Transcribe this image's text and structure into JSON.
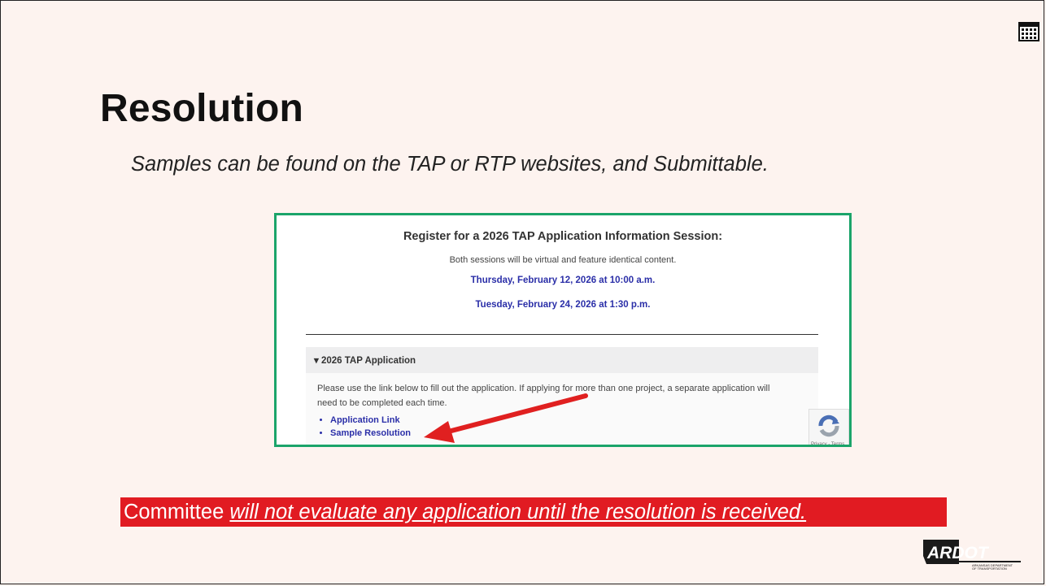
{
  "slide": {
    "title": "Resolution",
    "subtitle": "Samples can be found on the TAP or RTP websites, and Submittable."
  },
  "screenshot": {
    "register_heading": "Register for a 2026 TAP Application Information Session:",
    "sessions_note": "Both sessions will be virtual and feature identical content.",
    "session_1": "Thursday, February 12, 2026 at 10:00 a.m.",
    "session_2": "Tuesday, February 24, 2026 at 1:30 p.m.",
    "accordion_label": "▾ 2026 TAP Application",
    "instructions": "Please use the link below to fill out the application. If applying for more than one project, a separate application will need to be completed each time.",
    "links": [
      "Application Link",
      "Sample Resolution"
    ],
    "recaptcha_text": "Privacy - Terms"
  },
  "warning": {
    "prefix": "Committee ",
    "emphasis": "will not evaluate any application until the resolution is received."
  },
  "logo": {
    "text": "ARDOT",
    "tagline_1": "ARKANSAS DEPARTMENT",
    "tagline_2": "OF TRANSPORTATION"
  },
  "colors": {
    "background": "#fdf3ef",
    "frame_border": "#1ba46a",
    "warning_bg": "#e11b22",
    "link": "#2b2fa8",
    "arrow": "#e02020"
  },
  "icons": [
    "calendar-icon",
    "arrow-annotation",
    "recaptcha-icon",
    "ardot-logo"
  ]
}
